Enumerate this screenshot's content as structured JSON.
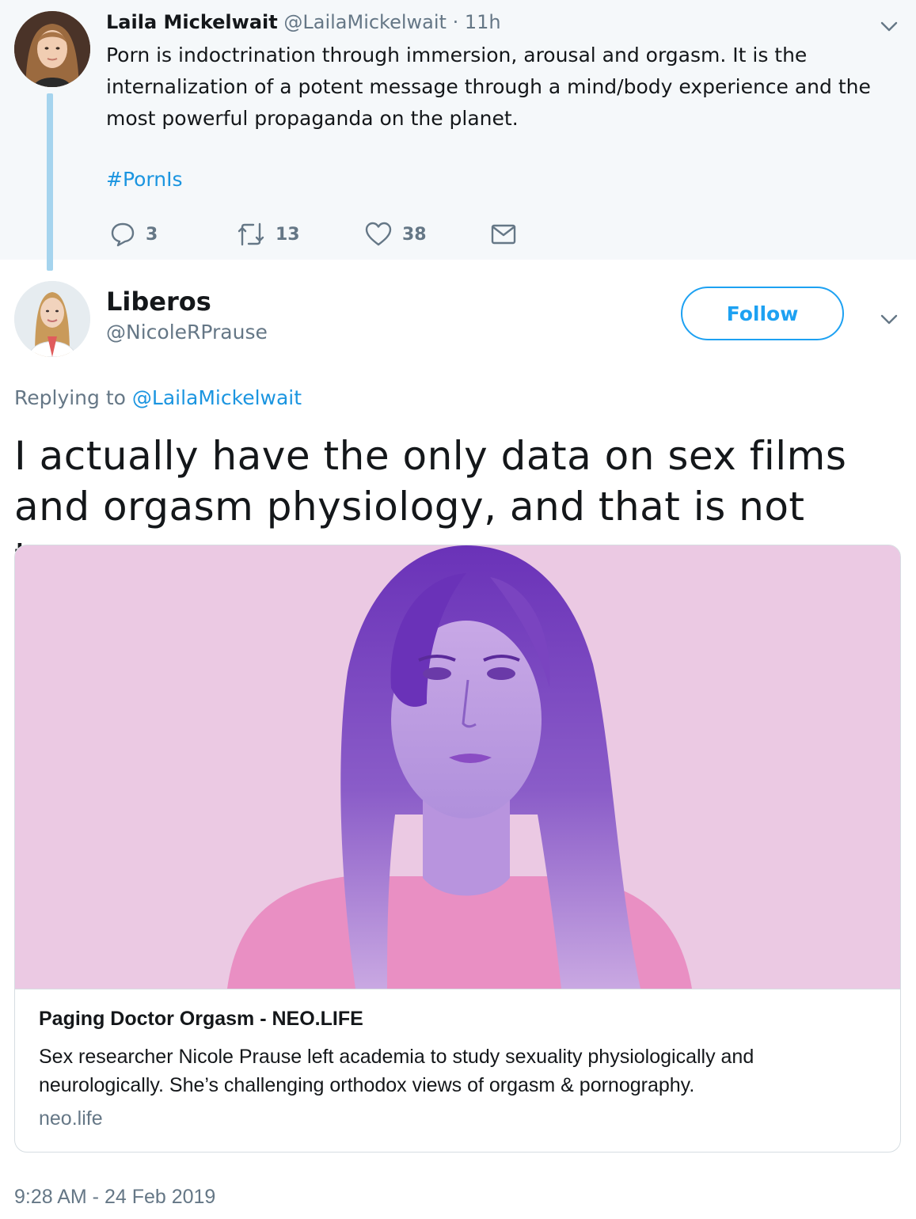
{
  "parent_tweet": {
    "author_name": "Laila Mickelwait",
    "author_handle": "@LailaMickelwait",
    "time": " · 11h",
    "text": "Porn is indoctrination through immersion, arousal and orgasm. It is the internalization of a potent message through a mind/body experience and the most powerful propaganda on the planet.",
    "hashtag": "#PornIs",
    "replies": "3",
    "retweets": "13",
    "likes": "38"
  },
  "main_tweet": {
    "author_name": "Liberos",
    "author_handle": "@NicoleRPrause",
    "follow_label": "Follow",
    "replying_prefix": "Replying to ",
    "replying_to": "@LailaMickelwait",
    "text": "I actually have the only data on sex films and orgasm physiology, and that is not true:",
    "card": {
      "title": "Paging Doctor Orgasm - NEO.LIFE",
      "description": "Sex researcher Nicole Prause left academia to study sexuality physiologically and neurologically. She’s challenging orthodox views of orgasm & pornography.",
      "domain": "neo.life"
    },
    "timestamp": "9:28 AM - 24 Feb 2019"
  },
  "colors": {
    "link": "#1b95e0",
    "muted": "#657786",
    "thread_line": "#a5d4ee",
    "parent_bg": "#f5f8fa",
    "card_image_bg": "#ebc9e3"
  },
  "icons": [
    "reply-icon",
    "retweet-icon",
    "like-icon",
    "message-icon",
    "chevron-down-icon"
  ]
}
